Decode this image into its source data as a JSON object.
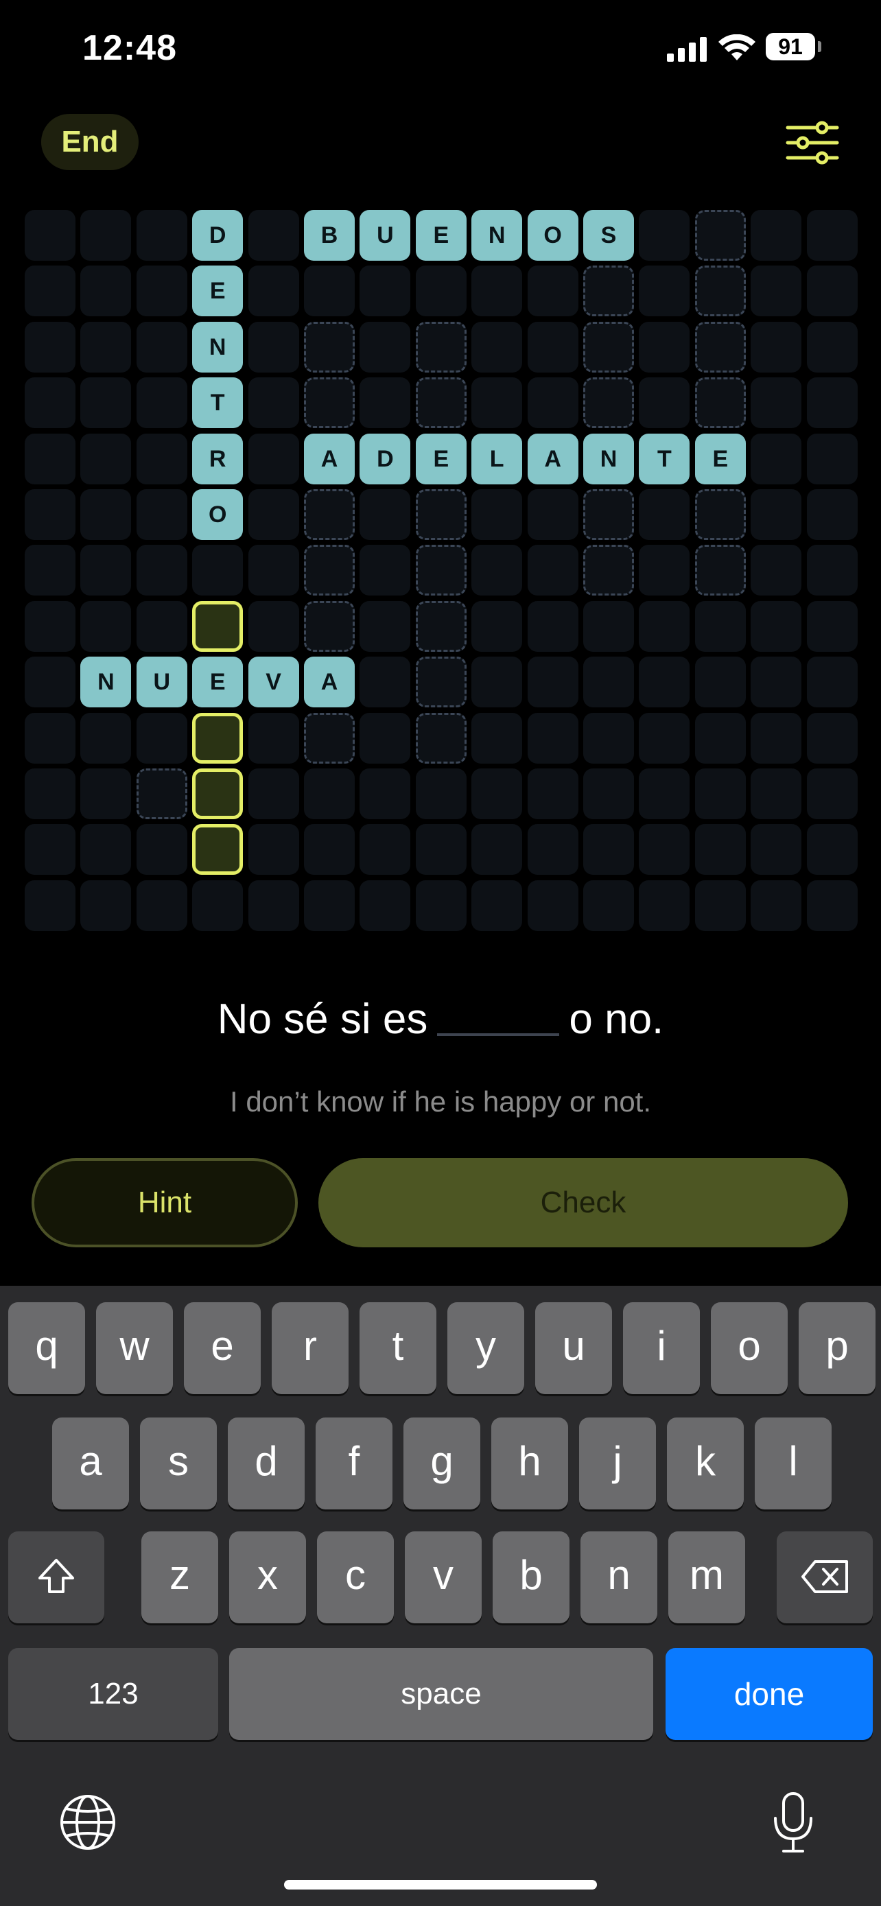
{
  "status_bar": {
    "time": "12:48",
    "battery": "91"
  },
  "header": {
    "end_label": "End",
    "settings_icon": "sliders-icon"
  },
  "grid": {
    "cols": 15,
    "rows": 13,
    "slots": [
      [
        0,
        12
      ],
      [
        1,
        10
      ],
      [
        1,
        12
      ],
      [
        2,
        5
      ],
      [
        2,
        7
      ],
      [
        2,
        10
      ],
      [
        2,
        12
      ],
      [
        3,
        5
      ],
      [
        3,
        7
      ],
      [
        3,
        10
      ],
      [
        3,
        12
      ],
      [
        5,
        5
      ],
      [
        5,
        7
      ],
      [
        5,
        10
      ],
      [
        5,
        12
      ],
      [
        6,
        5
      ],
      [
        6,
        7
      ],
      [
        6,
        10
      ],
      [
        6,
        12
      ],
      [
        7,
        5
      ],
      [
        7,
        7
      ],
      [
        8,
        7
      ],
      [
        9,
        5
      ],
      [
        9,
        7
      ],
      [
        10,
        2
      ]
    ],
    "active": [
      [
        7,
        3
      ],
      [
        9,
        3
      ],
      [
        10,
        3
      ],
      [
        11,
        3
      ]
    ],
    "words": [
      {
        "word": "BUENOS",
        "row": 0,
        "col": 5,
        "dir": "across"
      },
      {
        "word": "DENTRO",
        "row": 0,
        "col": 3,
        "dir": "down"
      },
      {
        "word": "ADELANTE",
        "row": 4,
        "col": 5,
        "dir": "across"
      },
      {
        "word": "NUEVA",
        "row": 8,
        "col": 1,
        "dir": "across"
      }
    ]
  },
  "prompt": {
    "before": "No sé si es",
    "after": "o no.",
    "translation": "I don’t know if he is happy or not."
  },
  "actions": {
    "hint_label": "Hint",
    "check_label": "Check"
  },
  "keyboard": {
    "row1": [
      "q",
      "w",
      "e",
      "r",
      "t",
      "y",
      "u",
      "i",
      "o",
      "p"
    ],
    "row2": [
      "a",
      "s",
      "d",
      "f",
      "g",
      "h",
      "j",
      "k",
      "l"
    ],
    "row3": [
      "z",
      "x",
      "c",
      "v",
      "b",
      "n",
      "m"
    ],
    "numbers_label": "123",
    "space_label": "space",
    "done_label": "done",
    "shift_icon": "shift-icon",
    "delete_icon": "backspace-icon",
    "globe_icon": "globe-icon",
    "mic_icon": "microphone-icon"
  },
  "colors": {
    "accent": "#e4ee66",
    "filled_tile": "#86c6c9",
    "check_button": "#4d5623",
    "done_key": "#0a7aff"
  }
}
